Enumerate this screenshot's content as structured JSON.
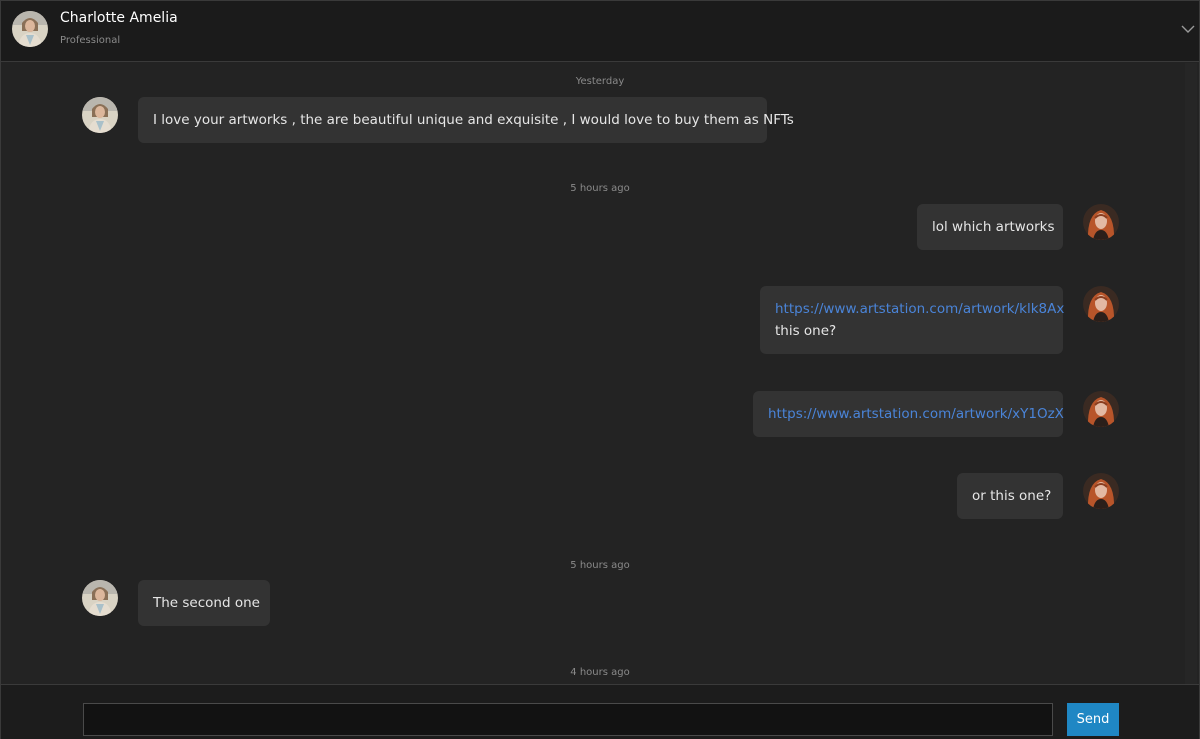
{
  "header": {
    "name": "Charlotte Amelia",
    "subtitle": "Professional",
    "collapse_icon": "chevron-down-icon"
  },
  "messages": {
    "separators": [
      "Yesterday",
      "5 hours ago",
      "5 hours ago",
      "4 hours ago"
    ],
    "m1": {
      "side": "left",
      "text": "I love your artworks , the are beautiful unique and exquisite , I would love to buy them as NFTs"
    },
    "m2": {
      "side": "right",
      "text": "lol which artworks"
    },
    "m3": {
      "side": "right",
      "link": "https://www.artstation.com/artwork/klk8Ax",
      "text": "this one?"
    },
    "m4": {
      "side": "right",
      "link": "https://www.artstation.com/artwork/xY1OzX"
    },
    "m5": {
      "side": "right",
      "text": "or this one?"
    },
    "m6": {
      "side": "left",
      "text": "The second one"
    }
  },
  "composer": {
    "input_value": "",
    "input_placeholder": "",
    "send_label": "Send"
  },
  "colors": {
    "accent": "#1f87c4",
    "link": "#4a84d8",
    "bubble": "#333333",
    "background": "#232323"
  }
}
